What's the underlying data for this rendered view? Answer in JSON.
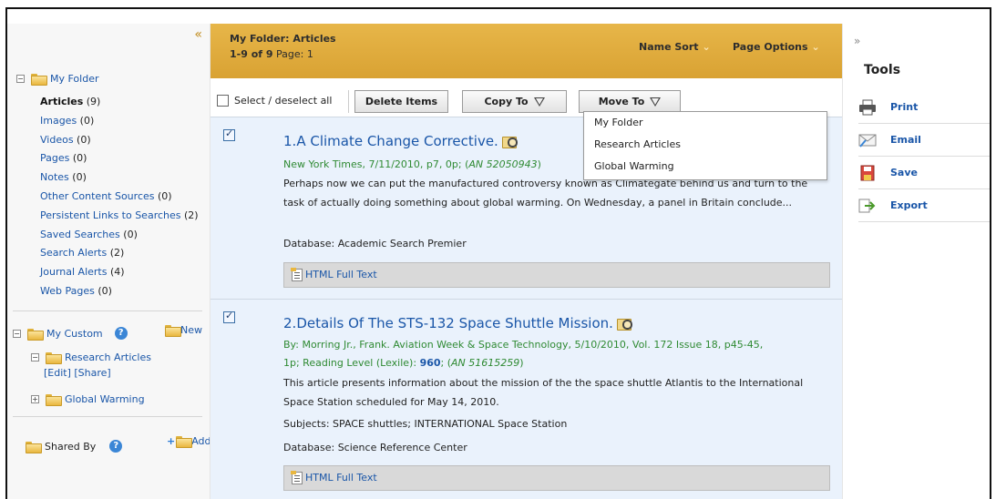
{
  "sidebar": {
    "collapse": "«",
    "my_folder": "My Folder",
    "items": [
      {
        "label": "Articles",
        "count": " (9)"
      },
      {
        "label": "Images",
        "count": " (0)"
      },
      {
        "label": "Videos",
        "count": " (0)"
      },
      {
        "label": "Pages",
        "count": " (0)"
      },
      {
        "label": "Notes",
        "count": " (0)"
      },
      {
        "label": "Other Content Sources",
        "count": " (0)"
      },
      {
        "label": "Persistent Links to Searches",
        "count": " (2)"
      },
      {
        "label": "Saved Searches",
        "count": " (0)"
      },
      {
        "label": "Search Alerts",
        "count": " (2)"
      },
      {
        "label": "Journal Alerts",
        "count": " (4)"
      },
      {
        "label": "Web Pages",
        "count": " (0)"
      }
    ],
    "my_custom": "My Custom",
    "new": "New",
    "research_articles": "Research Articles",
    "edit": "[Edit]",
    "share": "[Share]",
    "global_warming": "Global Warming",
    "shared_by": "Shared By",
    "add": "Add",
    "help": "?"
  },
  "header": {
    "title": "My Folder: Articles",
    "range": "1-9 of 9",
    "page_label": " Page: 1",
    "name_sort": "Name Sort",
    "page_options": "Page Options",
    "chev": "⌄"
  },
  "toolbar": {
    "select_all": "Select / deselect all",
    "delete": "Delete Items",
    "copy_to": "Copy To",
    "move_to": "Move To"
  },
  "move_to_menu": [
    "My Folder",
    "Research Articles",
    "Global Warming"
  ],
  "results": [
    {
      "num": "1.",
      "title": "A Climate Change Corrective.",
      "source": "New York Times, 7/11/2010, p7, 0p; (",
      "an": "AN 52050943",
      "abstract": "Perhaps now we can put the manufactured controversy known as Climategate behind us and turn to the task of actually doing something about global warming. On Wednesday, a panel in Britain conclude...",
      "database": "Database: Academic Search Premier",
      "fulltext": "HTML Full Text"
    },
    {
      "num": "2.",
      "title": "Details Of The STS-132 Space Shuttle Mission.",
      "source1": "By: Morring Jr., Frank. Aviation Week & Space Technology, 5/10/2010, Vol. 172 Issue 18, p45-45,",
      "source2a": "1p; Reading Level (Lexile): ",
      "lexile": "960",
      "source2b": "; (",
      "an": "AN 51615259",
      "abstract": "This article presents information about the mission of the the space shuttle Atlantis to the International Space Station scheduled for May 14, 2010.",
      "subjects": "Subjects: SPACE shuttles; INTERNATIONAL Space Station",
      "database": "Database: Science Reference Center",
      "fulltext": "HTML Full Text"
    }
  ],
  "tools": {
    "collapse": "»",
    "title": "Tools",
    "items": [
      "Print",
      "Email",
      "Save",
      "Export"
    ]
  },
  "colors": {
    "header_gold": "#d9a233",
    "link_blue": "#1a56a8",
    "source_green": "#2f8a33",
    "result_bg": "#eaf2fc"
  }
}
